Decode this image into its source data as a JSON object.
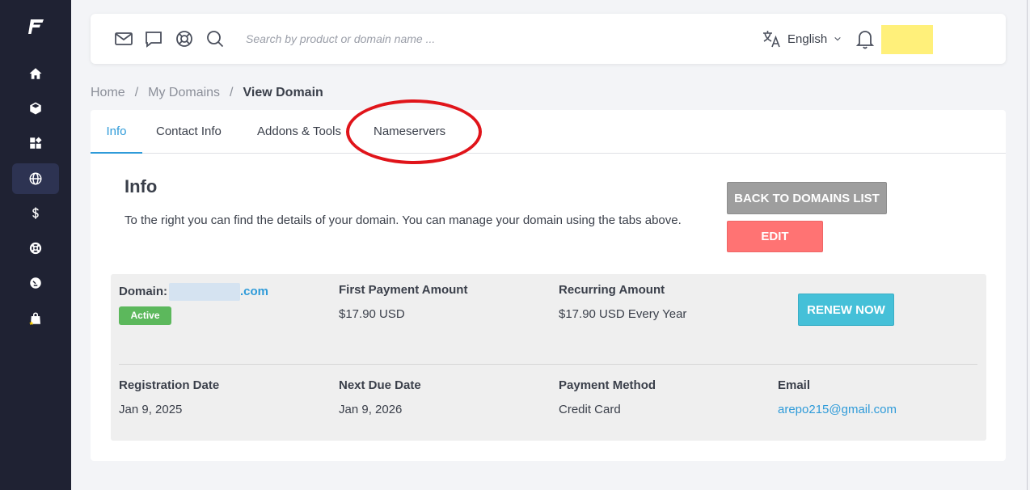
{
  "search": {
    "placeholder": "Search by product or domain name ..."
  },
  "header": {
    "language": "English"
  },
  "breadcrumb": {
    "home": "Home",
    "sep": "/",
    "my_domains": "My Domains",
    "current": "View Domain"
  },
  "tabs": [
    {
      "label": "Info"
    },
    {
      "label": "Contact Info"
    },
    {
      "label": "Addons & Tools"
    },
    {
      "label": "Nameservers"
    }
  ],
  "info": {
    "title": "Info",
    "description": "To the right you can find the details of your domain. You can manage your domain using the tabs above."
  },
  "buttons": {
    "back": "BACK TO DOMAINS LIST",
    "edit": "EDIT",
    "renew": "RENEW NOW"
  },
  "details": {
    "domain_label": "Domain:",
    "domain_tld": ".com",
    "status": "Active",
    "first_payment_label": "First Payment Amount",
    "first_payment_value": "$17.90 USD",
    "recurring_label": "Recurring Amount",
    "recurring_value": "$17.90 USD Every Year",
    "registration_label": "Registration Date",
    "registration_value": "Jan 9, 2025",
    "next_due_label": "Next Due Date",
    "next_due_value": "Jan 9, 2026",
    "payment_method_label": "Payment Method",
    "payment_method_value": "Credit Card",
    "email_label": "Email",
    "email_value": "arepo215@gmail.com"
  },
  "colors": {
    "sidebar": "#1f2233",
    "accent": "#2f9bd9",
    "active_badge": "#5cb85c",
    "edit": "#ff7373",
    "renew": "#45c0d8",
    "annotation": "#e0141a"
  }
}
